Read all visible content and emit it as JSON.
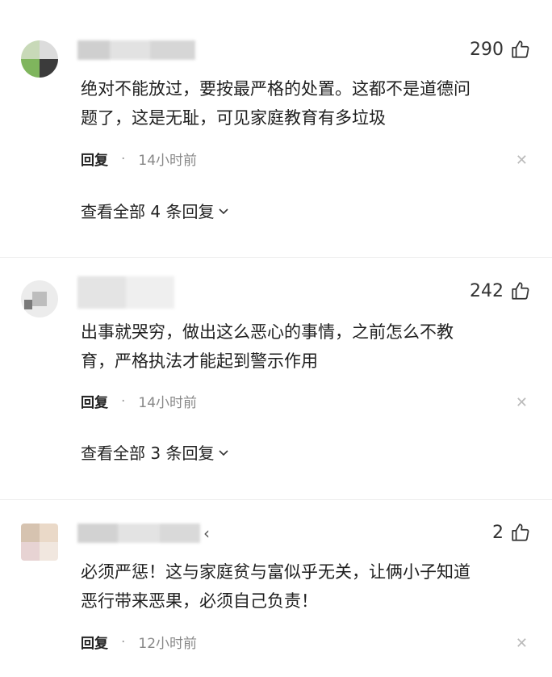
{
  "comments": [
    {
      "likes": "290",
      "body_line1": "绝对不能放过，要按最严格的处置。这都不是道德问",
      "body_line2": "题了，这是无耻，可见家庭教育有多垃圾",
      "reply_label": "回复",
      "dot": "·",
      "time": "14小时前",
      "view_all": "查看全部 4 条回复"
    },
    {
      "likes": "242",
      "body_line1": "出事就哭穷，做出这么恶心的事情，之前怎么不教",
      "body_line2": "育，严格执法才能起到警示作用",
      "reply_label": "回复",
      "dot": "·",
      "time": "14小时前",
      "view_all": "查看全部 3 条回复"
    },
    {
      "likes": "2",
      "body_line1": "必须严惩！这与家庭贫与富似乎无关，让俩小子知道",
      "body_line2": "恶行带来恶果，必须自己负责！",
      "reply_label": "回复",
      "dot": "·",
      "time": "12小时前",
      "username_suffix": "‹"
    }
  ],
  "icons": {
    "like": "thumbs-up-icon",
    "close": "close-icon",
    "expand": "chevron-down-icon"
  },
  "colors": {
    "text": "#1f1f1f",
    "muted": "#888888",
    "divider": "#ededed"
  }
}
